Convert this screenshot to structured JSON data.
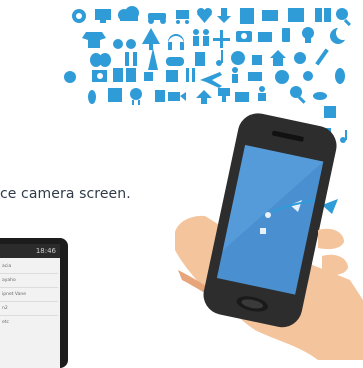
{
  "caption": {
    "text": "ce camera screen."
  },
  "mini_phone": {
    "status_time": "18:46",
    "rows": [
      "acia",
      "ayaho",
      "ipnet Vane",
      "n2",
      "etc"
    ]
  },
  "colors": {
    "icon_blue": "#2f9bd7",
    "skin": "#f4c49c",
    "skin_shadow": "#e6a57a",
    "phone_body": "#2d2d2d",
    "phone_screen": "#4a8fd0",
    "caption_text": "#2f3b4b"
  },
  "icons": [
    "camera-icon",
    "globe-icon",
    "phone-icon",
    "music-note-icon",
    "car-icon",
    "coffee-icon",
    "heart-icon",
    "home-icon",
    "plane-icon",
    "mail-icon",
    "book-icon",
    "gear-icon",
    "cloud-icon",
    "bicycle-icon",
    "headphones-icon",
    "tv-icon",
    "sun-icon",
    "tree-icon",
    "cart-icon",
    "search-icon"
  ]
}
